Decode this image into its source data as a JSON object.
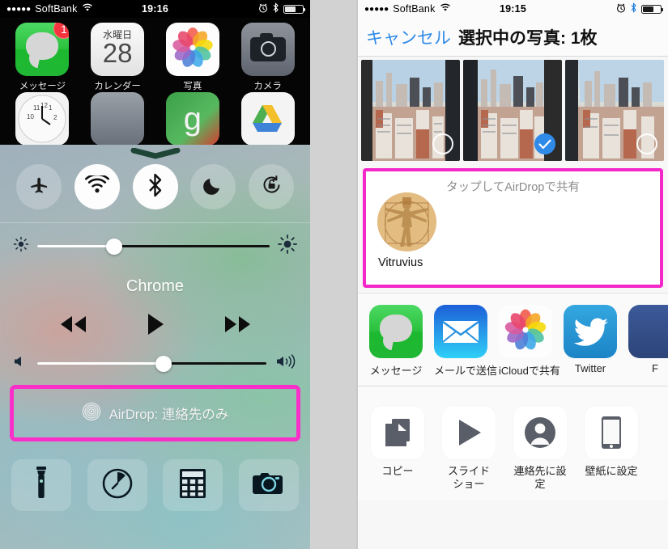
{
  "left_phone": {
    "status_bar": {
      "signal_dots": "●●●●●",
      "carrier": "SoftBank",
      "wifi_icon": "wifi-icon",
      "time": "19:16",
      "alarm_icon": "alarm-clock-icon",
      "bluetooth_icon": "bluetooth-icon",
      "battery_icon": "battery-icon"
    },
    "home_screen": {
      "apps": [
        {
          "label": "メッセージ",
          "icon": "messages-icon",
          "badge": "1"
        },
        {
          "label": "カレンダー",
          "icon": "calendar-icon",
          "day_of_week": "水曜日",
          "day_number": "28"
        },
        {
          "label": "写真",
          "icon": "photos-icon"
        },
        {
          "label": "カメラ",
          "icon": "camera-icon"
        }
      ],
      "second_row": [
        {
          "icon": "clock-icon"
        },
        {
          "icon": "stocks-icon"
        },
        {
          "icon": "google-icon",
          "glyph": "g"
        },
        {
          "icon": "google-drive-icon"
        }
      ]
    },
    "control_center": {
      "grabber": "grabber-handle",
      "toggles": [
        {
          "name": "airplane-mode",
          "icon": "airplane-icon",
          "state": "off"
        },
        {
          "name": "wifi",
          "icon": "wifi-icon",
          "state": "on"
        },
        {
          "name": "bluetooth",
          "icon": "bluetooth-icon",
          "state": "on"
        },
        {
          "name": "do-not-disturb",
          "icon": "moon-icon",
          "state": "off"
        },
        {
          "name": "rotation-lock",
          "icon": "rotation-lock-icon",
          "state": "off"
        }
      ],
      "brightness": {
        "low_icon": "brightness-low-icon",
        "high_icon": "brightness-high-icon",
        "value_percent": 33
      },
      "now_playing_title": "Chrome",
      "media_buttons": [
        {
          "name": "previous-track",
          "icon": "rewind-icon"
        },
        {
          "name": "play",
          "icon": "play-icon"
        },
        {
          "name": "next-track",
          "icon": "fast-forward-icon"
        }
      ],
      "volume": {
        "low_icon": "volume-low-icon",
        "high_icon": "volume-high-icon",
        "value_percent": 55
      },
      "airdrop": {
        "icon": "airdrop-icon",
        "label": "AirDrop: 連絡先のみ",
        "highlight_color": "#fa2ec8"
      },
      "quick_actions": [
        {
          "name": "flashlight",
          "icon": "flashlight-icon"
        },
        {
          "name": "timer",
          "icon": "timer-icon"
        },
        {
          "name": "calculator",
          "icon": "calculator-icon"
        },
        {
          "name": "camera",
          "icon": "camera-icon"
        }
      ]
    }
  },
  "right_phone": {
    "status_bar": {
      "signal_dots": "●●●●●",
      "carrier": "SoftBank",
      "wifi_icon": "wifi-icon",
      "time": "19:15",
      "alarm_icon": "alarm-clock-icon",
      "bluetooth_icon": "bluetooth-icon",
      "battery_icon": "battery-icon"
    },
    "nav_bar": {
      "cancel_label": "キャンセル",
      "title": "選択中の写真: 1枚"
    },
    "photos": [
      {
        "name": "photo-thumbnail-1",
        "selected": false
      },
      {
        "name": "photo-thumbnail-2",
        "selected": true
      },
      {
        "name": "photo-thumbnail-3",
        "selected": false
      }
    ],
    "airdrop_section": {
      "hint": "タップしてAirDropで共有",
      "highlight_color": "#f428c8",
      "contacts": [
        {
          "name": "Vitruvius",
          "avatar": "vitruvian-man-avatar"
        }
      ]
    },
    "share_targets": [
      {
        "label": "メッセージ",
        "icon": "messages-icon"
      },
      {
        "label": "メールで送信",
        "icon": "mail-icon"
      },
      {
        "label": "iCloudで共有",
        "icon": "icloud-photos-icon"
      },
      {
        "label": "Twitter",
        "icon": "twitter-icon"
      },
      {
        "label": "F",
        "icon": "facebook-icon"
      }
    ],
    "actions": [
      {
        "label": "コピー",
        "icon": "copy-icon"
      },
      {
        "label": "スライド\nショー",
        "label_line1": "スライド",
        "label_line2": "ショー",
        "icon": "slideshow-play-icon"
      },
      {
        "label": "連絡先に設定",
        "icon": "contact-person-icon"
      },
      {
        "label": "壁紙に設定",
        "icon": "phone-wallpaper-icon"
      }
    ]
  }
}
